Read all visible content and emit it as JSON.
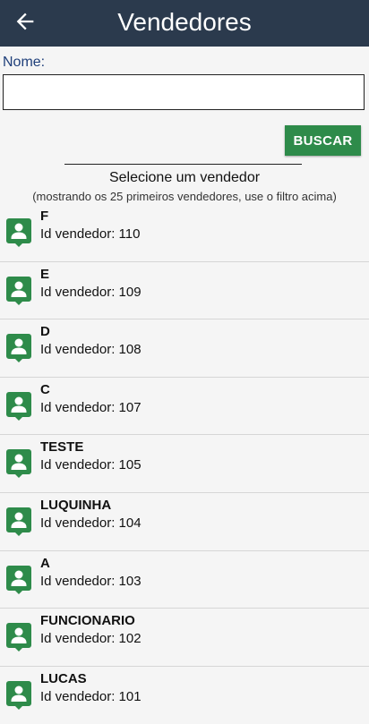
{
  "header": {
    "title": "Vendedores",
    "back_icon": "arrow-left-icon"
  },
  "search": {
    "label": "Nome:",
    "value": "",
    "button": "BUSCAR"
  },
  "list": {
    "heading": "Selecione um vendedor",
    "hint": "(mostrando os 25 primeiros vendedores, use o filtro acima)",
    "items": [
      {
        "name": "F",
        "id": "Id vendedor: 110"
      },
      {
        "name": "E",
        "id": "Id vendedor: 109"
      },
      {
        "name": "D",
        "id": "Id vendedor: 108"
      },
      {
        "name": "C",
        "id": "Id vendedor: 107"
      },
      {
        "name": "TESTE",
        "id": "Id vendedor: 105"
      },
      {
        "name": "LUQUINHA",
        "id": "Id vendedor: 104"
      },
      {
        "name": "A",
        "id": "Id vendedor: 103"
      },
      {
        "name": "FUNCIONARIO",
        "id": "Id vendedor: 102"
      },
      {
        "name": "LUCAS",
        "id": "Id vendedor: 101"
      }
    ]
  },
  "colors": {
    "appbar": "#2b3a4d",
    "accent": "#2e8b4a",
    "label": "#1f3f7a"
  }
}
